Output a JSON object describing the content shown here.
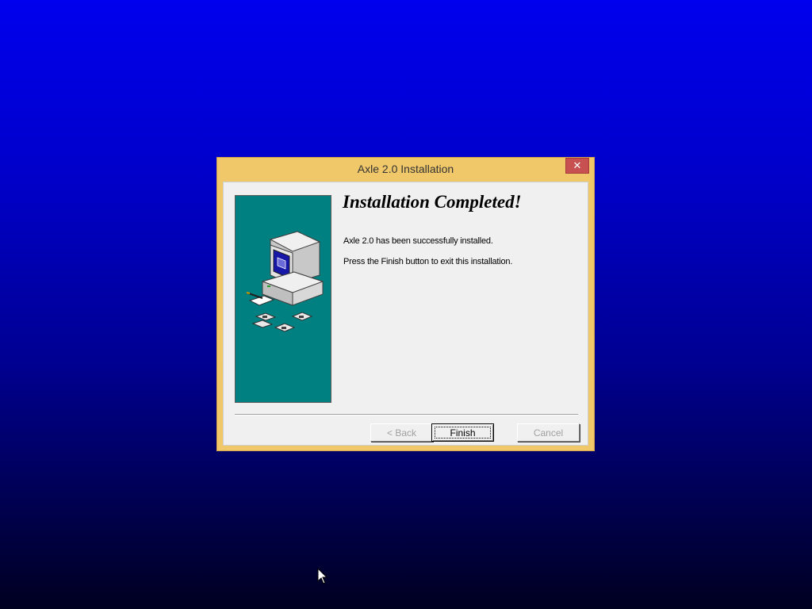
{
  "window": {
    "title": "Axle 2.0 Installation",
    "close_glyph": "✕"
  },
  "content": {
    "heading": "Installation Completed!",
    "message_1": "Axle 2.0 has been successfully installed.",
    "message_2": "Press the Finish button to exit this installation."
  },
  "buttons": {
    "back_label": "< Back",
    "finish_label": "Finish",
    "cancel_label": "Cancel",
    "back_enabled": false,
    "finish_enabled": true,
    "cancel_enabled": false
  },
  "colors": {
    "frame": "#f0c86a",
    "side_panel": "#008080",
    "close_button": "#c75050",
    "desktop_top": "#0000ee",
    "desktop_bottom": "#000020"
  },
  "icons": {
    "side_illustration": "computer-with-floppy-disks-icon",
    "cursor": "mouse-pointer-icon"
  }
}
